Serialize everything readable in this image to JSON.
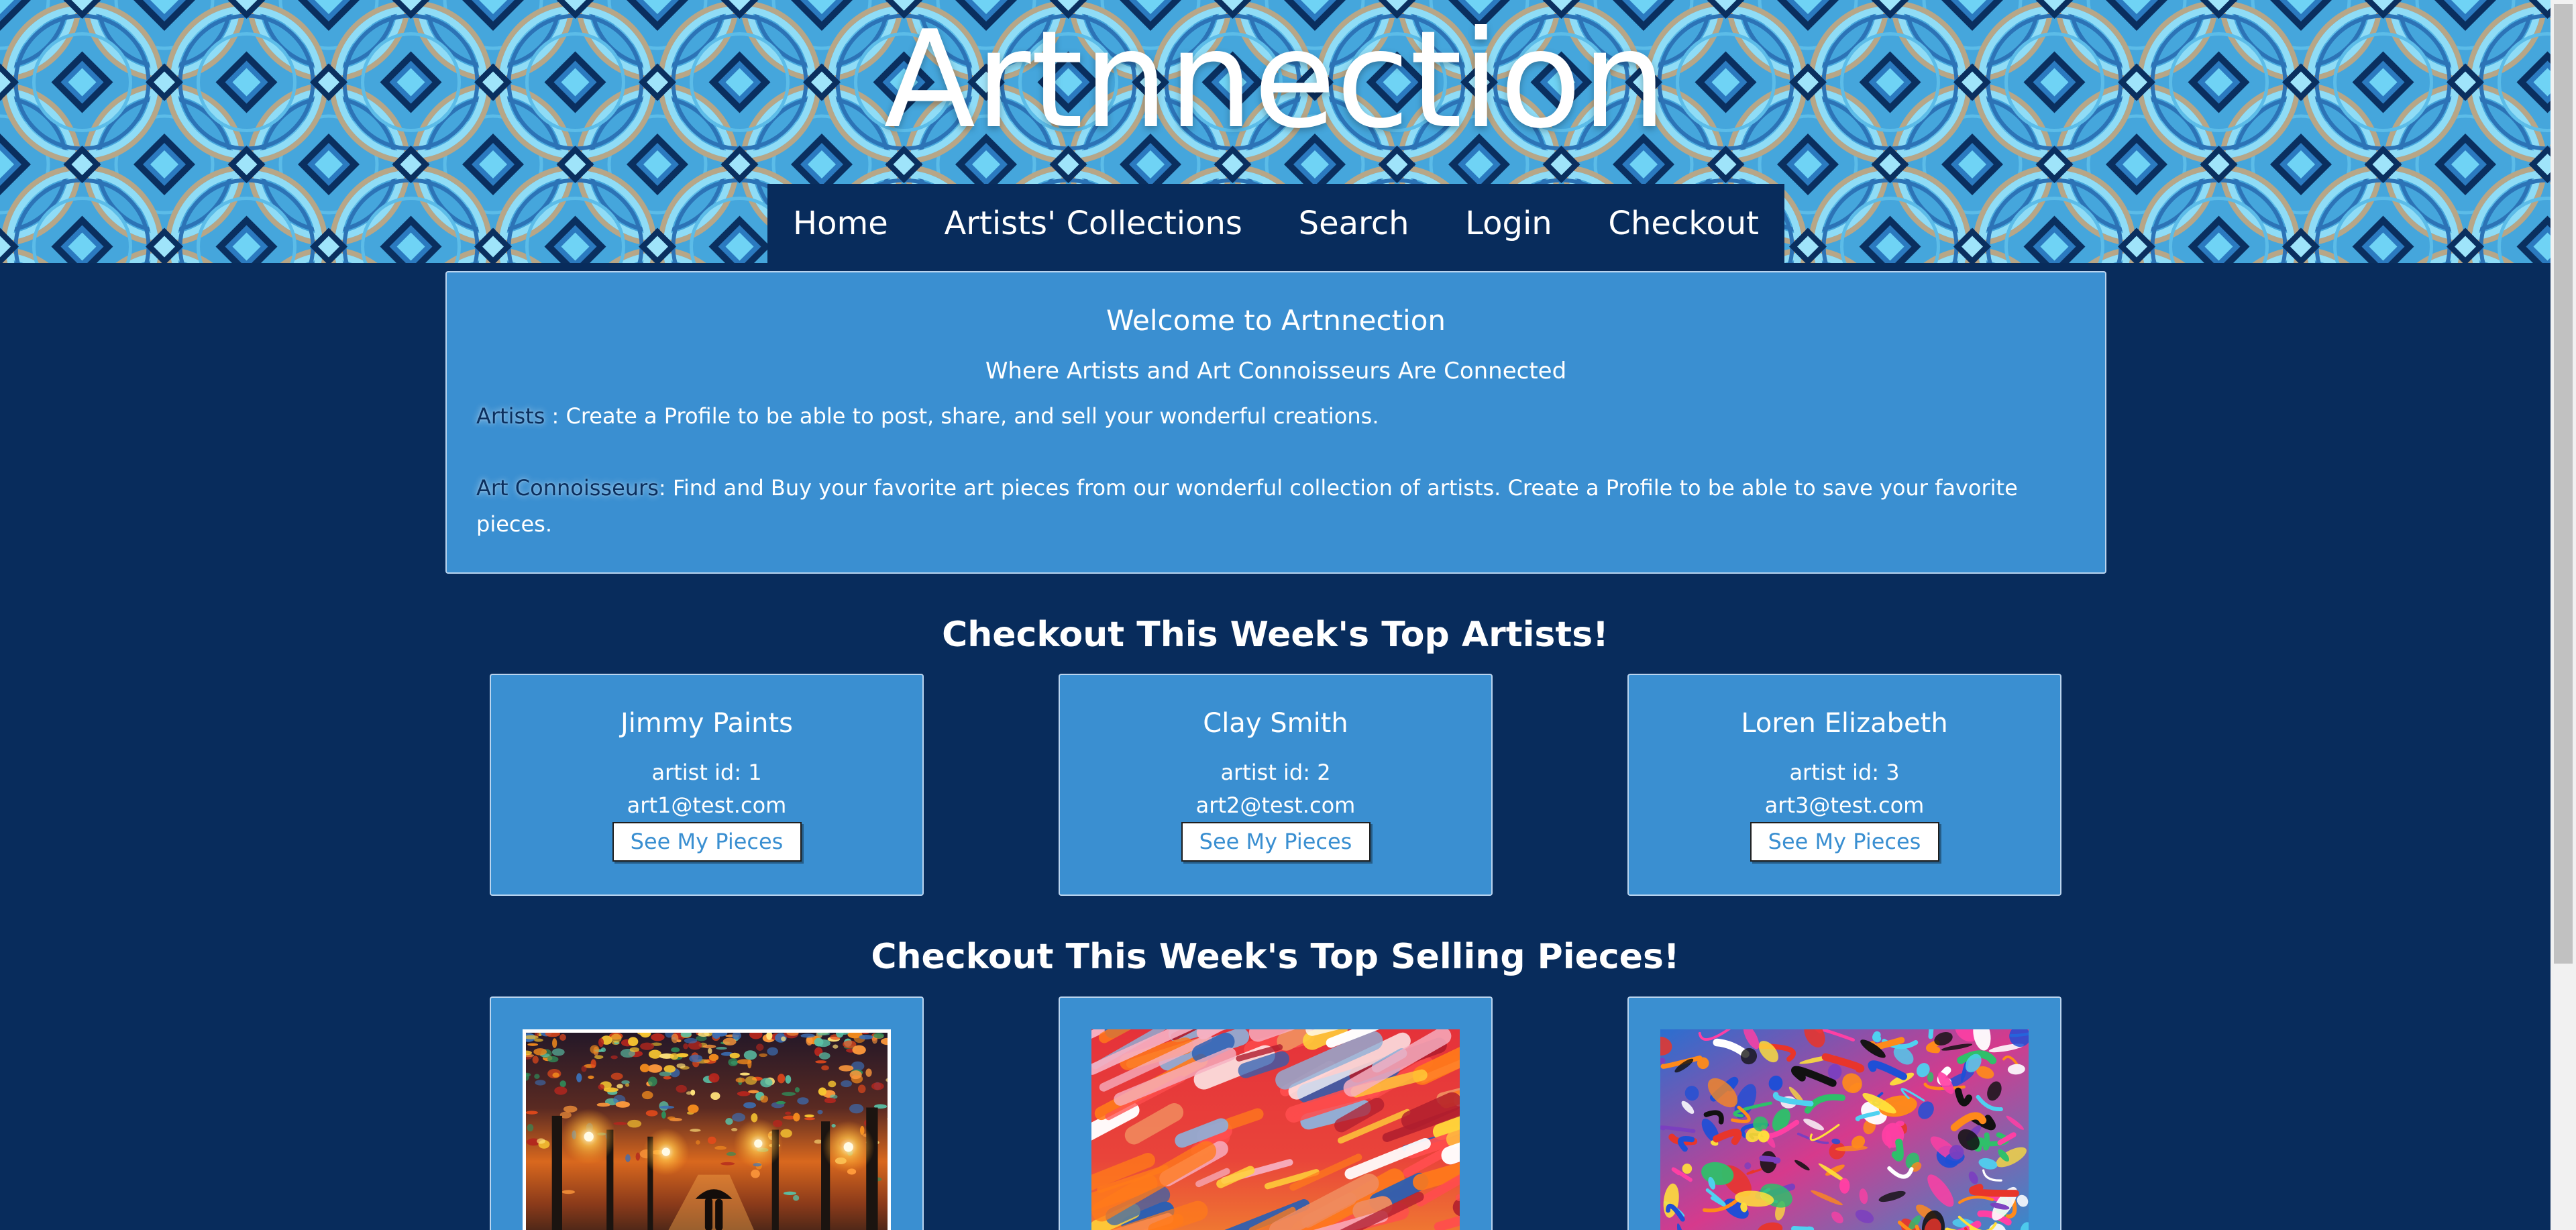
{
  "colors": {
    "page_bg": "#082c5c",
    "panel_bg": "#3a8fd1",
    "nav_bg": "#082c5c",
    "label_text": "#0b2f5e",
    "button_text": "#3a8fd1"
  },
  "site": {
    "title": "Artnnection"
  },
  "nav": {
    "items": [
      {
        "label": "Home"
      },
      {
        "label": "Artists' Collections"
      },
      {
        "label": "Search"
      },
      {
        "label": "Login"
      },
      {
        "label": "Checkout"
      }
    ]
  },
  "welcome": {
    "title": "Welcome to Artnnection",
    "subtitle": "Where Artists and Art Connoisseurs Are Connected",
    "artists_label": "Artists",
    "artists_text": " : Create a Profile to be able to post, share, and sell your wonderful creations.",
    "connoisseurs_label": "Art Connoisseurs",
    "connoisseurs_text": ": Find and Buy your favorite art pieces from our wonderful collection of artists. Create a Profile to be able to save your favorite pieces."
  },
  "top_artists": {
    "heading": "Checkout This Week's Top Artists!",
    "artists": [
      {
        "name": "Jimmy Paints",
        "id_label": "artist id: 1",
        "email": "art1@test.com",
        "button_label": "See My Pieces"
      },
      {
        "name": "Clay Smith",
        "id_label": "artist id: 2",
        "email": "art2@test.com",
        "button_label": "See My Pieces"
      },
      {
        "name": "Loren Elizabeth",
        "id_label": "artist id: 3",
        "email": "art3@test.com",
        "button_label": "See My Pieces"
      }
    ]
  },
  "top_pieces": {
    "heading": "Checkout This Week's Top Selling Pieces!"
  }
}
